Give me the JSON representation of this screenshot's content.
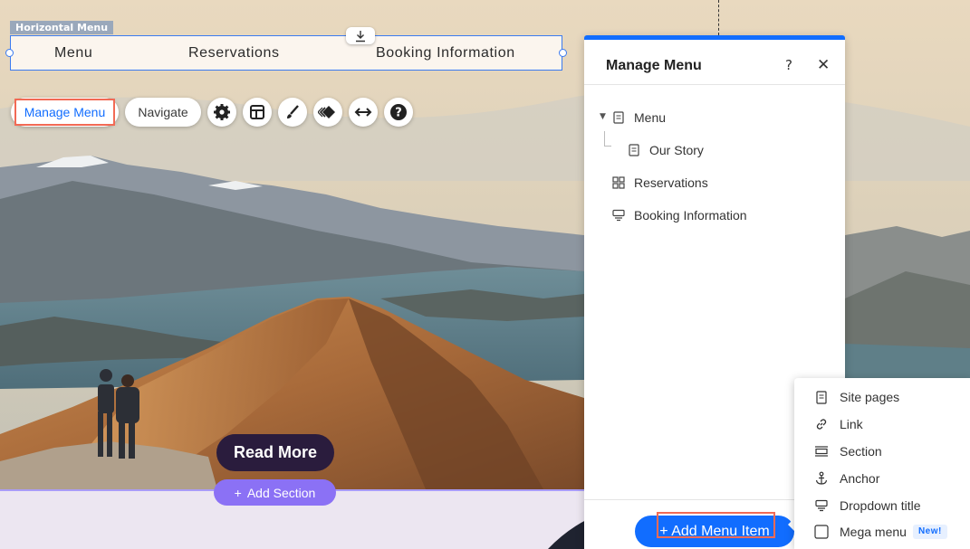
{
  "horizontal_menu": {
    "tag": "Horizontal Menu",
    "items": [
      "Menu",
      "Reservations",
      "Booking Information"
    ]
  },
  "toolbar": {
    "manage_menu": "Manage Menu",
    "navigate": "Navigate",
    "icons": [
      "gear-icon",
      "layout-icon",
      "brush-icon",
      "animation-icon",
      "stretch-icon",
      "help-icon"
    ]
  },
  "hero": {
    "read_more": "Read More",
    "add_section": "Add Section",
    "add_section_prefix": "+"
  },
  "panel": {
    "title": "Manage Menu",
    "help": "?",
    "close": "✕",
    "tree": [
      {
        "label": "Menu",
        "icon": "page-icon",
        "level": 0,
        "expanded": true
      },
      {
        "label": "Our Story",
        "icon": "page-icon",
        "level": 1
      },
      {
        "label": "Reservations",
        "icon": "app-icon",
        "level": 0
      },
      {
        "label": "Booking Information",
        "icon": "dropdown-title-icon",
        "level": 0
      }
    ],
    "add_item": "+ Add Menu Item"
  },
  "dropdown": {
    "items": [
      {
        "label": "Site pages",
        "icon": "page-icon"
      },
      {
        "label": "Link",
        "icon": "link-icon"
      },
      {
        "label": "Section",
        "icon": "section-icon"
      },
      {
        "label": "Anchor",
        "icon": "anchor-icon"
      },
      {
        "label": "Dropdown title",
        "icon": "dropdown-title-icon"
      },
      {
        "label": "Mega menu",
        "icon": "mega-menu-icon",
        "badge": "New!"
      }
    ]
  },
  "colors": {
    "accent": "#116dff",
    "highlight": "#f26a55",
    "add_section": "#8b71f5",
    "read_more": "#2a1c3d"
  }
}
